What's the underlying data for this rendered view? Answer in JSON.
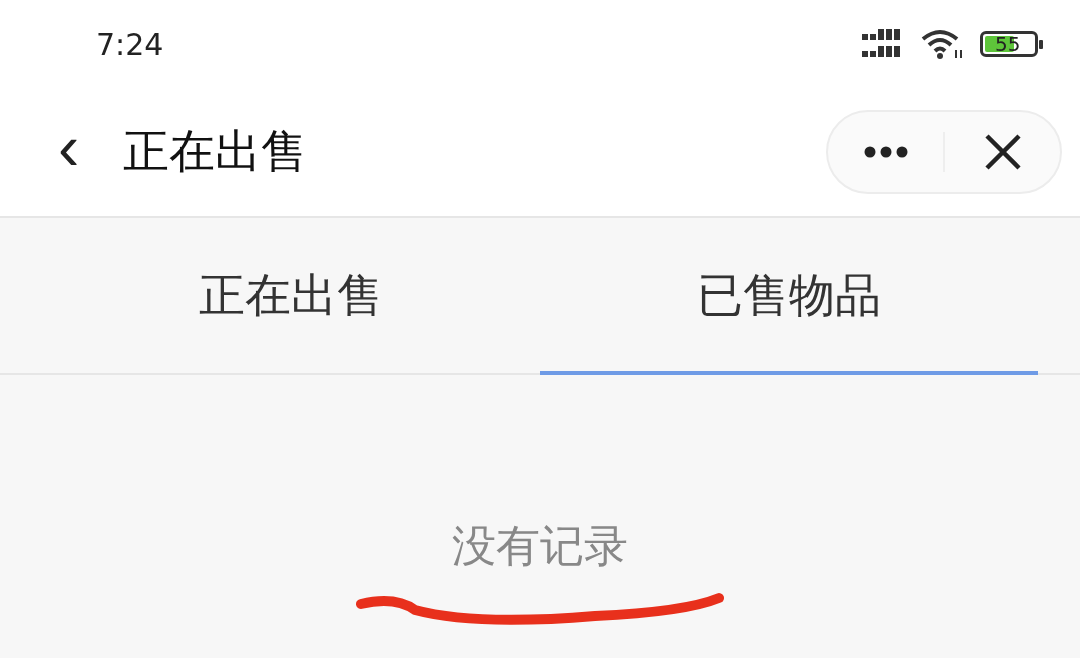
{
  "status_bar": {
    "time": "7:24",
    "battery": "55"
  },
  "header": {
    "back": "‹",
    "title": "正在出售"
  },
  "tabs": [
    {
      "label": "正在出售",
      "selected": false
    },
    {
      "label": "已售物品",
      "selected": true
    }
  ],
  "empty_message": "没有记录"
}
